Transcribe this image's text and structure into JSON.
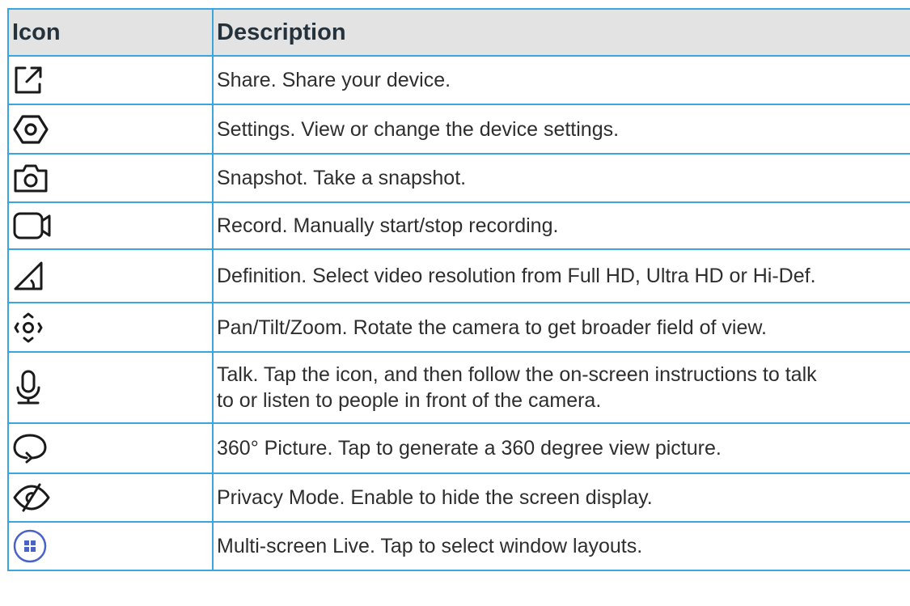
{
  "table": {
    "headers": {
      "icon": "Icon",
      "description": "Description"
    },
    "rows": [
      {
        "icon": "share-icon",
        "description": "Share. Share your device."
      },
      {
        "icon": "settings-icon",
        "description": "Settings. View or change the device settings."
      },
      {
        "icon": "snapshot-camera-icon",
        "description": "Snapshot. Take a snapshot."
      },
      {
        "icon": "record-video-icon",
        "description": "Record. Manually start/stop recording."
      },
      {
        "icon": "definition-icon",
        "description": "Definition. Select video resolution from Full HD, Ultra HD or Hi-Def."
      },
      {
        "icon": "pan-tilt-zoom-icon",
        "description": "Pan/Tilt/Zoom. Rotate the camera to get broader field of view."
      },
      {
        "icon": "talk-microphone-icon",
        "description_line1": "Talk. Tap the icon, and then follow the on-screen instructions to talk",
        "description_line2": "to or listen to people in front of the camera."
      },
      {
        "icon": "panorama-360-icon",
        "description": "360° Picture. Tap to generate a 360 degree view picture."
      },
      {
        "icon": "privacy-mode-icon",
        "description": "Privacy Mode. Enable to hide the screen display."
      },
      {
        "icon": "multi-screen-icon",
        "description": "Multi-screen Live. Tap to select window layouts."
      }
    ]
  },
  "colors": {
    "border": "#3ba5de",
    "header_background": "#e3e3e3",
    "icon_stroke": "#1a1a1a",
    "multi_screen_accent": "#4a63c8"
  }
}
